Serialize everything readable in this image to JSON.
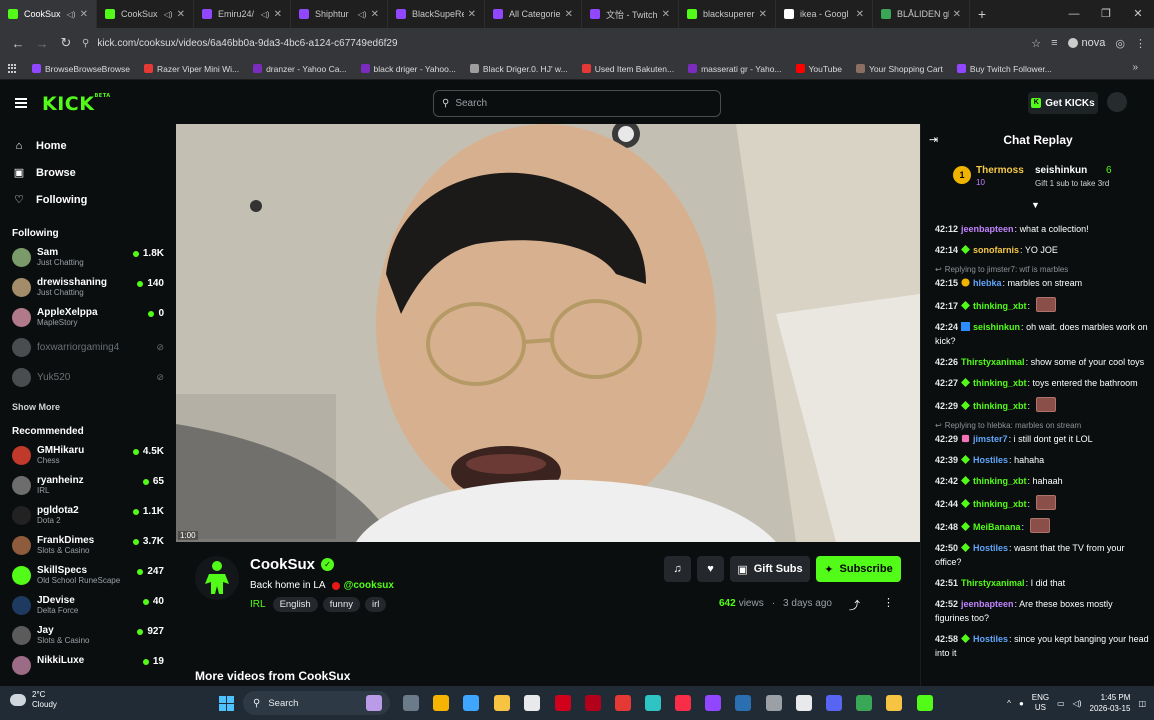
{
  "browser": {
    "tabs": [
      {
        "title": "CookSux",
        "icon": "kick-favicon",
        "color": "#53fc18",
        "active": true,
        "audio": true
      },
      {
        "title": "CookSux",
        "icon": "kick-favicon",
        "color": "#53fc18",
        "audio": true
      },
      {
        "title": "Emiru24/",
        "icon": "twitch-favicon",
        "color": "#9146ff",
        "audio": true
      },
      {
        "title": "Shiphtur",
        "icon": "twitch-favicon",
        "color": "#9146ff",
        "audio": true
      },
      {
        "title": "BlackSupeRe",
        "icon": "twitch-favicon",
        "color": "#9146ff"
      },
      {
        "title": "All Categorie",
        "icon": "twitch-favicon",
        "color": "#9146ff"
      },
      {
        "title": "文怡 - Twitch",
        "icon": "twitch-favicon",
        "color": "#9146ff"
      },
      {
        "title": "blacksuperer",
        "icon": "kick-favicon",
        "color": "#53fc18"
      },
      {
        "title": "ikea - Googl",
        "icon": "google-favicon",
        "color": "#ffffff"
      },
      {
        "title": "BLÅLIDEN gl",
        "icon": "ikea-favicon",
        "color": "#3aa757"
      }
    ],
    "url": "kick.com/cooksux/videos/6a46bb0a-9da3-4bc6-a124-c67749ed6f29",
    "profile_name": "nova",
    "bookmarks": [
      {
        "label": "BrowseBrowseBrowse",
        "color": "#9146ff"
      },
      {
        "label": "Razer Viper Mini Wi...",
        "color": "#e53935"
      },
      {
        "label": "dranzer - Yahoo Ca...",
        "color": "#7b2cbf"
      },
      {
        "label": "black driger - Yahoo...",
        "color": "#7b2cbf"
      },
      {
        "label": "Black Driger.0. HJ' w...",
        "color": "#9e9e9e"
      },
      {
        "label": "Used Item Bakuten...",
        "color": "#e53935"
      },
      {
        "label": "masserati gr - Yaho...",
        "color": "#7b2cbf"
      },
      {
        "label": "YouTube",
        "color": "#ff0000"
      },
      {
        "label": "Your Shopping Cart",
        "color": "#8d6e63"
      },
      {
        "label": "Buy Twitch Follower...",
        "color": "#9146ff"
      }
    ]
  },
  "kick": {
    "logo": "KICK",
    "logo_beta": "BETA",
    "search_placeholder": "Search",
    "get_kicks": "Get KICKs"
  },
  "sidebar": {
    "nav": [
      {
        "label": "Home",
        "icon": "home-icon",
        "glyph": "⌂"
      },
      {
        "label": "Browse",
        "icon": "browse-icon",
        "glyph": "▣"
      },
      {
        "label": "Following",
        "icon": "heart-icon",
        "glyph": "♡"
      }
    ],
    "following_title": "Following",
    "following": [
      {
        "name": "Sam",
        "sub": "Just Chatting",
        "viewers": "1.8K",
        "live": true,
        "color": "#7a9a6a"
      },
      {
        "name": "drewisshaning",
        "sub": "Just Chatting",
        "viewers": "140",
        "live": true,
        "color": "#a38c6a"
      },
      {
        "name": "AppleXelppa",
        "sub": "MapleStory",
        "viewers": "0",
        "live": true,
        "color": "#b07a8a"
      },
      {
        "name": "foxwarriorgaming4",
        "sub": "",
        "viewers": "",
        "live": false,
        "color": "#4a4d50"
      },
      {
        "name": "Yuk520",
        "sub": "",
        "viewers": "",
        "live": false,
        "color": "#4a4d50"
      }
    ],
    "show_more": "Show More",
    "recommended_title": "Recommended",
    "recommended": [
      {
        "name": "GMHikaru",
        "sub": "Chess",
        "viewers": "4.5K",
        "color": "#c0392b"
      },
      {
        "name": "ryanheinz",
        "sub": "IRL",
        "viewers": "65",
        "color": "#6d6d6d"
      },
      {
        "name": "pgldota2",
        "sub": "Dota 2",
        "viewers": "1.1K",
        "color": "#222"
      },
      {
        "name": "FrankDimes",
        "sub": "Slots & Casino",
        "viewers": "3.7K",
        "color": "#8e5b3c"
      },
      {
        "name": "SkillSpecs",
        "sub": "Old School RuneScape",
        "viewers": "247",
        "color": "#53fc18"
      },
      {
        "name": "JDevise",
        "sub": "Delta Force",
        "viewers": "40",
        "color": "#1f3a60"
      },
      {
        "name": "Jay",
        "sub": "Slots & Casino",
        "viewers": "927",
        "color": "#5b5b5b"
      },
      {
        "name": "NikkiLuxe",
        "sub": "",
        "viewers": "19",
        "color": "#9c6b85"
      }
    ]
  },
  "video": {
    "time": "1:00",
    "channel": "CookSux",
    "title": "Back home in LA",
    "mention": "@cooksux",
    "category": "IRL",
    "tags": [
      "English",
      "funny",
      "irl"
    ],
    "views": "642",
    "views_label": "views",
    "age": "3 days ago",
    "gift_subs": "Gift Subs",
    "subscribe": "Subscribe",
    "more_videos": "More videos from CookSux"
  },
  "chat": {
    "title": "Chat Replay",
    "pinned": {
      "rank": "1",
      "user": "Thermoss",
      "user_sub": "10",
      "gifter": "seishinkun",
      "count": "6",
      "text": "Gift 1 sub to take 3rd"
    },
    "messages": [
      {
        "ts": "42:12",
        "user": "jeenbapteen",
        "color": "#c084fc",
        "badge": "",
        "text": "what a collection!"
      },
      {
        "ts": "42:14",
        "user": "sonofarnis",
        "color": "#f7c948",
        "badge": "diamond",
        "text": "YO JOE"
      },
      {
        "ts": "42:15",
        "user": "hlebka",
        "color": "#60a5fa",
        "badge": "coin",
        "text": "marbles on stream",
        "reply": "Replying to jimster7: wtf is marbles"
      },
      {
        "ts": "42:17",
        "user": "thinking_xbt",
        "color": "#53fc18",
        "badge": "diamond",
        "text": "",
        "emote": true
      },
      {
        "ts": "42:24",
        "user": "seishinkun",
        "color": "#53fc18",
        "badge": "sq",
        "text": "oh wait. does marbles work on kick?"
      },
      {
        "ts": "42:26",
        "user": "Thirstyxanimal",
        "color": "#53fc18",
        "badge": "",
        "text": "show some of your cool toys"
      },
      {
        "ts": "42:27",
        "user": "thinking_xbt",
        "color": "#53fc18",
        "badge": "diamond",
        "text": "toys entered the bathroom"
      },
      {
        "ts": "42:29",
        "user": "thinking_xbt",
        "color": "#53fc18",
        "badge": "diamond",
        "text": "",
        "emote": true
      },
      {
        "ts": "42:29",
        "user": "jimster7",
        "color": "#60a5fa",
        "badge": "gift",
        "text": "i still dont get it LOL",
        "reply": "Replying to hlebka: marbles on stream"
      },
      {
        "ts": "42:39",
        "user": "Hostiles",
        "color": "#60a5fa",
        "badge": "diamond",
        "text": "hahaha"
      },
      {
        "ts": "42:42",
        "user": "thinking_xbt",
        "color": "#53fc18",
        "badge": "diamond",
        "text": "hahaah"
      },
      {
        "ts": "42:44",
        "user": "thinking_xbt",
        "color": "#53fc18",
        "badge": "diamond",
        "text": "",
        "emote": true
      },
      {
        "ts": "42:48",
        "user": "MeiBanana",
        "color": "#53fc18",
        "badge": "diamond",
        "text": "",
        "emote": true
      },
      {
        "ts": "42:50",
        "user": "Hostiles",
        "color": "#60a5fa",
        "badge": "diamond",
        "text": "wasnt that the TV from your office?"
      },
      {
        "ts": "42:51",
        "user": "Thirstyxanimal",
        "color": "#53fc18",
        "badge": "",
        "text": "I did that"
      },
      {
        "ts": "42:52",
        "user": "jeenbapteen",
        "color": "#c084fc",
        "badge": "",
        "text": "Are these boxes mostly figurines too?"
      },
      {
        "ts": "42:58",
        "user": "Hostiles",
        "color": "#60a5fa",
        "badge": "diamond",
        "text": "since you kept banging your head into it"
      }
    ]
  },
  "taskbar": {
    "temp": "2°C",
    "weather": "Cloudy",
    "search": "Search",
    "lang1": "ENG",
    "lang2": "US",
    "time": "1:45 PM",
    "date": "2026-03-15"
  },
  "colors": {
    "accent": "#53fc18",
    "bg": "#0b0e0f"
  }
}
